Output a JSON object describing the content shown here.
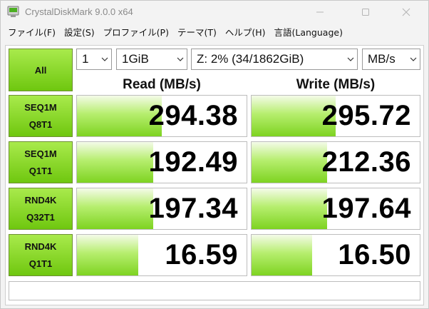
{
  "window": {
    "title": "CrystalDiskMark 9.0.0 x64",
    "icon": "crystaldiskmark-app-icon",
    "controls": [
      "minimize-icon",
      "maximize-icon",
      "close-icon"
    ]
  },
  "menu": [
    {
      "label": "ファイル(F)"
    },
    {
      "label": "設定(S)"
    },
    {
      "label": "プロファイル(P)"
    },
    {
      "label": "テーマ(T)"
    },
    {
      "label": "ヘルプ(H)"
    },
    {
      "label": "言語(Language)"
    }
  ],
  "controls": {
    "all_label": "All",
    "count": "1",
    "size": "1GiB",
    "drive": "Z: 2% (34/1862GiB)",
    "unit": "MB/s"
  },
  "headers": {
    "read": "Read (MB/s)",
    "write": "Write (MB/s)"
  },
  "tests": [
    {
      "line1": "SEQ1M",
      "line2": "Q8T1",
      "read": "294.38",
      "write": "295.72",
      "read_fill": 0.5,
      "write_fill": 0.5
    },
    {
      "line1": "SEQ1M",
      "line2": "Q1T1",
      "read": "192.49",
      "write": "212.36",
      "read_fill": 0.45,
      "write_fill": 0.45
    },
    {
      "line1": "RND4K",
      "line2": "Q32T1",
      "read": "197.34",
      "write": "197.64",
      "read_fill": 0.45,
      "write_fill": 0.45
    },
    {
      "line1": "RND4K",
      "line2": "Q1T1",
      "read": "16.59",
      "write": "16.50",
      "read_fill": 0.36,
      "write_fill": 0.36
    }
  ],
  "colors": {
    "accent_green": "#7ed321",
    "label_green": "#8cd62c"
  },
  "status": ""
}
